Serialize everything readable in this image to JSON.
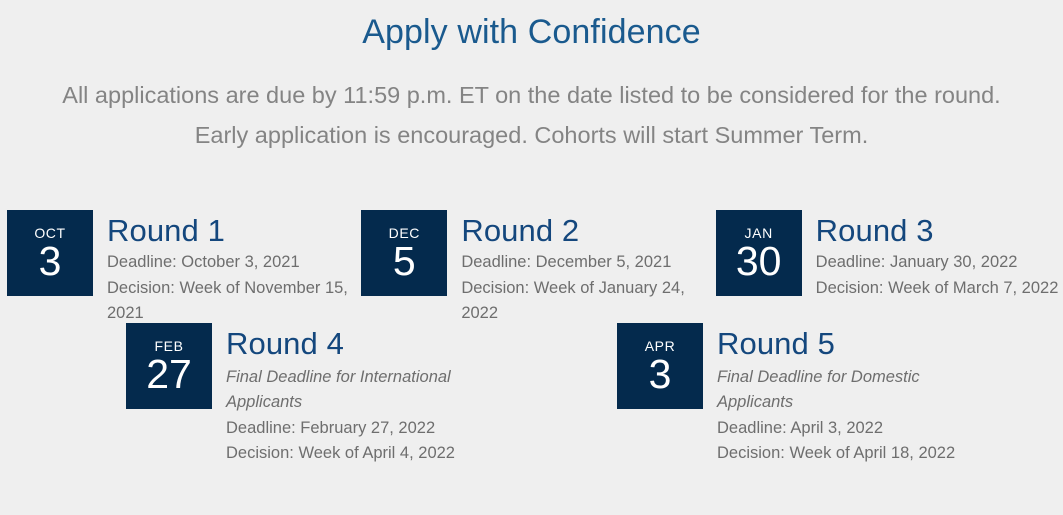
{
  "header": {
    "title": "Apply with Confidence",
    "intro_line_1": "All applications are due by 11:59 p.m. ET on the date listed to be considered for the round.",
    "intro_line_2": "Early application is encouraged. Cohorts will start Summer Term."
  },
  "colors": {
    "background": "#efefef",
    "page_title": "#1a5a8e",
    "intro_text": "#848484",
    "round_title": "#14477d",
    "badge_background": "#042a4d",
    "badge_text": "#ffffff",
    "body_text": "#6e6e6e"
  },
  "rounds": [
    {
      "month": "OCT",
      "day": "3",
      "title": "Round 1",
      "note": "",
      "deadline": "Deadline: October 3, 2021",
      "decision": "Decision: Week of November 15, 2021"
    },
    {
      "month": "DEC",
      "day": "5",
      "title": "Round 2",
      "note": "",
      "deadline": "Deadline: December 5, 2021",
      "decision": "Decision: Week of January 24, 2022"
    },
    {
      "month": "JAN",
      "day": "30",
      "title": "Round 3",
      "note": "",
      "deadline": "Deadline: January 30, 2022",
      "decision": "Decision: Week of March 7, 2022"
    },
    {
      "month": "FEB",
      "day": "27",
      "title": "Round 4",
      "note": "Final Deadline for International Applicants",
      "deadline": "Deadline: February 27, 2022",
      "decision": "Decision: Week of April 4, 2022"
    },
    {
      "month": "APR",
      "day": "3",
      "title": "Round 5",
      "note": "Final Deadline for Domestic Applicants",
      "deadline": "Deadline: April 3, 2022",
      "decision": "Decision: Week of April 18, 2022"
    }
  ]
}
